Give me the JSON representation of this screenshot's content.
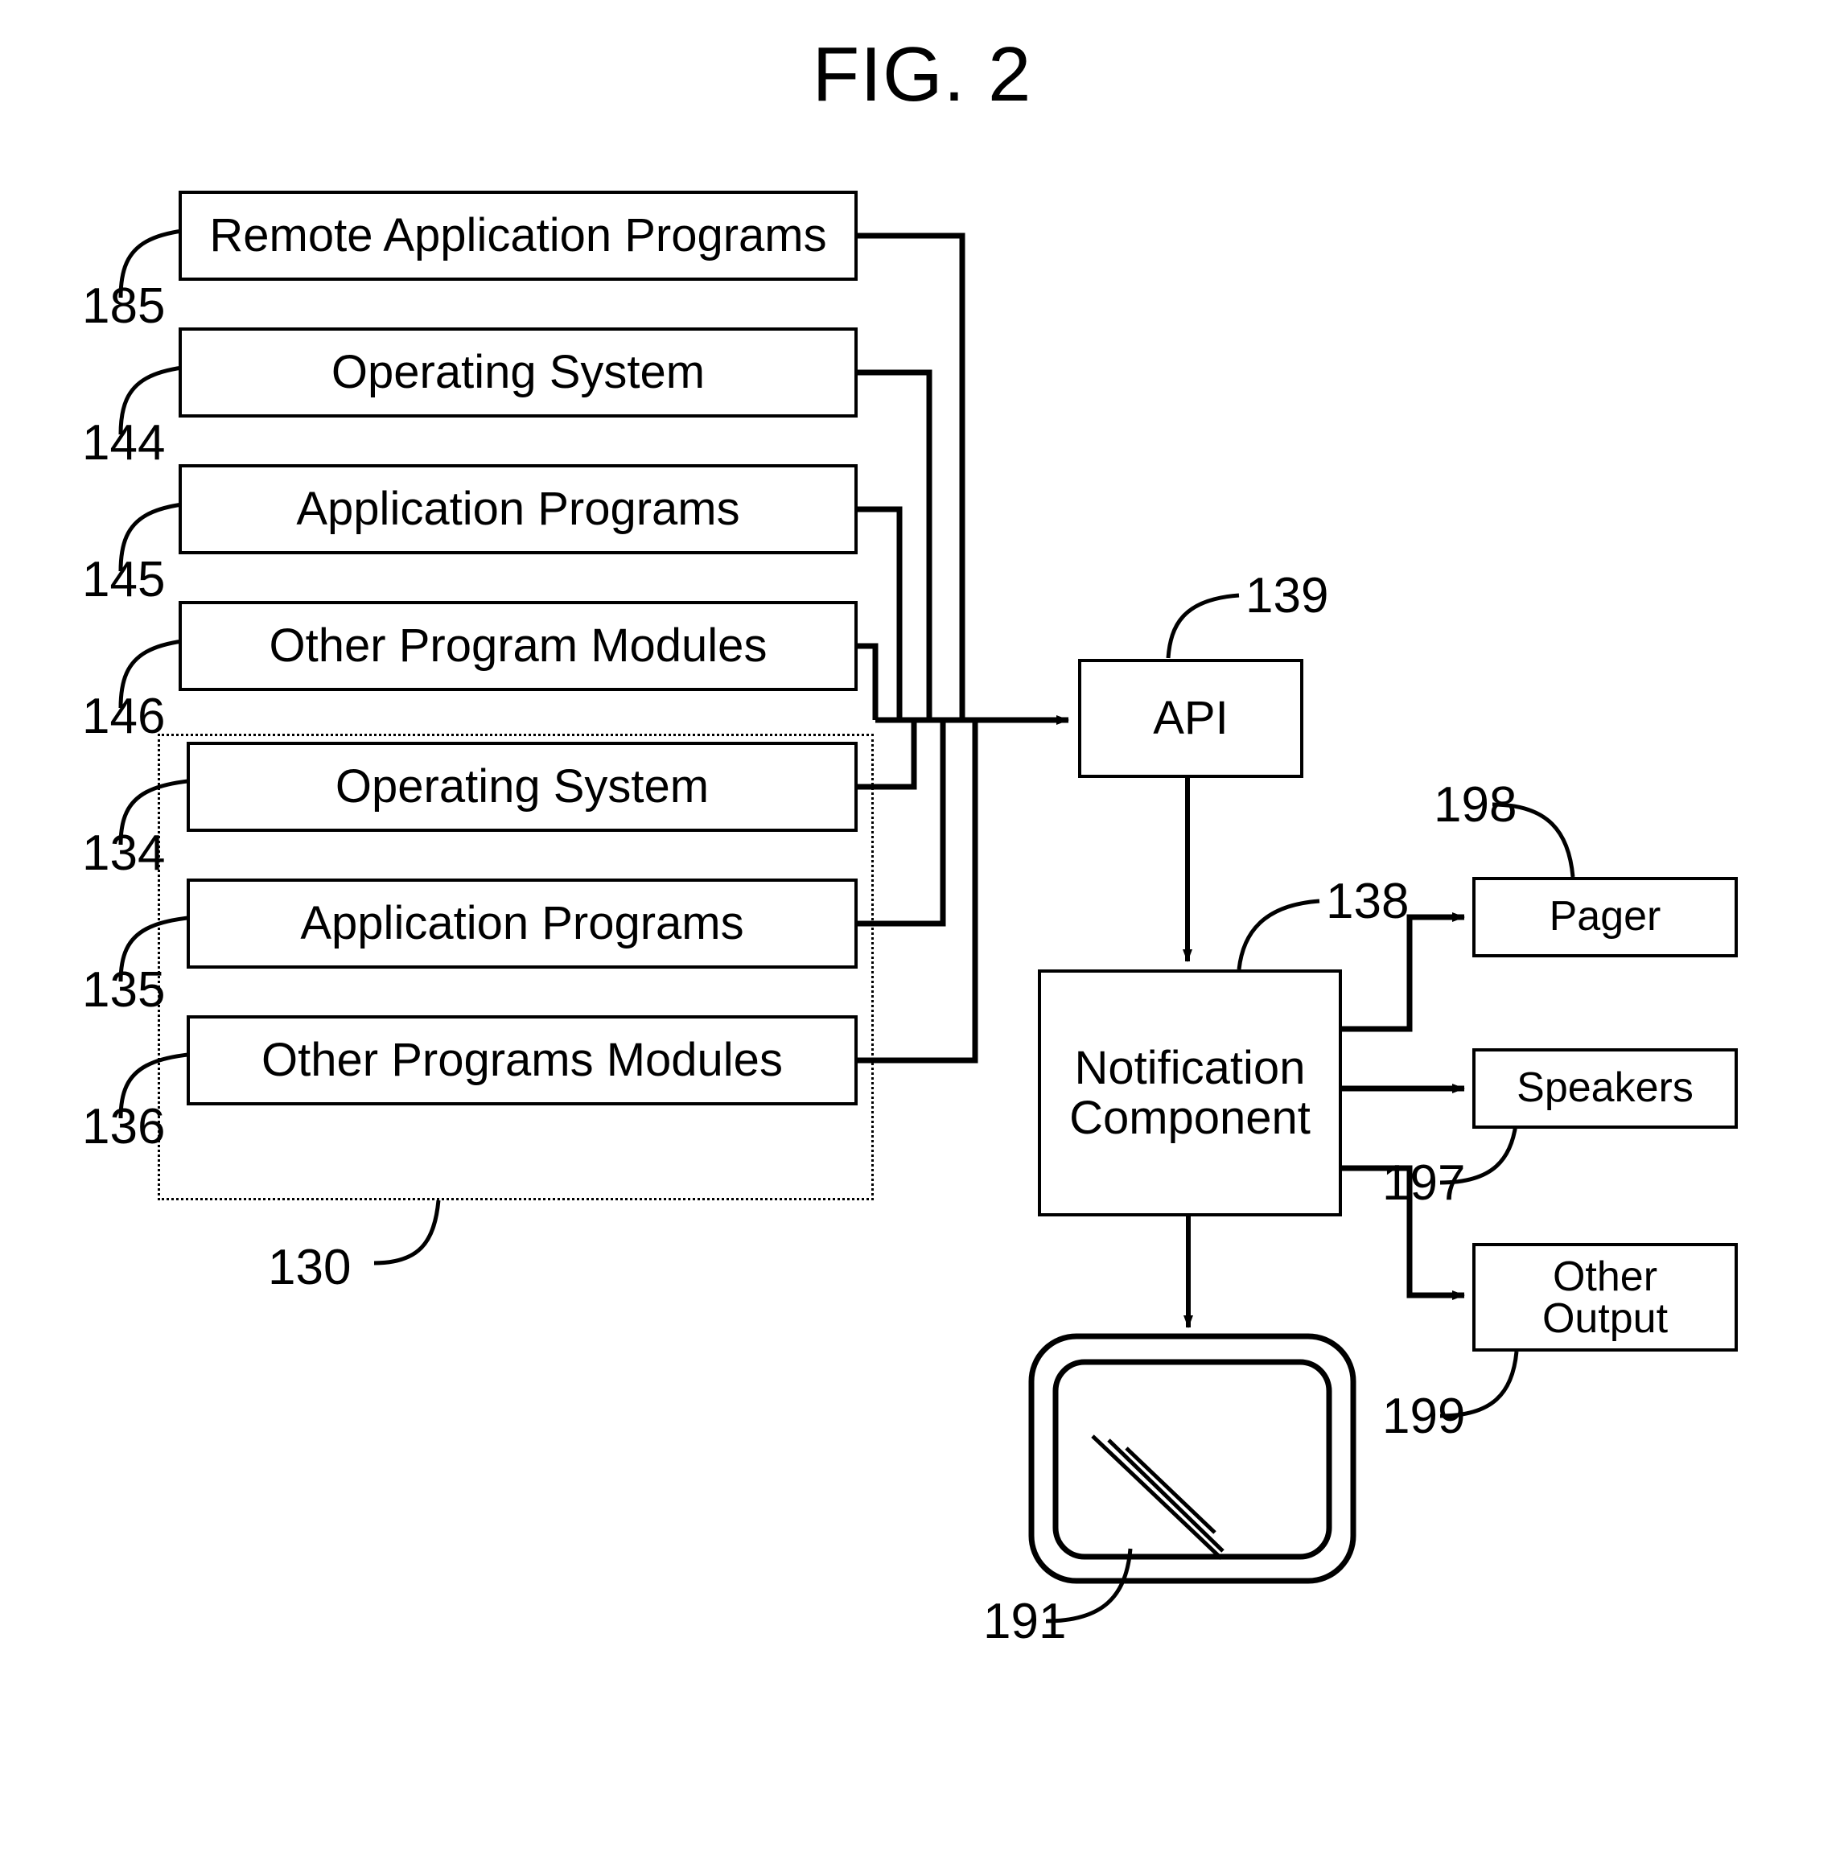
{
  "figure": {
    "title": "FIG. 2",
    "background_color": "#ffffff",
    "line_color": "#000000"
  },
  "nodes": {
    "remote_application_programs": {
      "label": "Remote Application Programs",
      "ref": "185"
    },
    "operating_system_upper": {
      "label": "Operating System",
      "ref": "144"
    },
    "application_programs_upper": {
      "label": "Application Programs",
      "ref": "145"
    },
    "other_program_modules_upper": {
      "label": "Other Program Modules",
      "ref": "146"
    },
    "operating_system_lower": {
      "label": "Operating System",
      "ref": "134"
    },
    "application_programs_lower": {
      "label": "Application Programs",
      "ref": "135"
    },
    "other_programs_modules_lower": {
      "label": "Other Programs Modules",
      "ref": "136"
    },
    "memory_group": {
      "ref": "130"
    },
    "api": {
      "label": "API",
      "ref": "139"
    },
    "notification_component": {
      "label": "Notification\nComponent",
      "label_line1": "Notification",
      "label_line2": "Component",
      "ref": "138"
    },
    "pager": {
      "label": "Pager",
      "ref": "198"
    },
    "speakers": {
      "label": "Speakers",
      "ref": "197"
    },
    "other_output": {
      "label": "Other\nOutput",
      "label_line1": "Other",
      "label_line2": "Output",
      "ref": "199"
    },
    "display_monitor": {
      "label": "",
      "ref": "191"
    }
  },
  "ref_numbers": {
    "n185": "185",
    "n144": "144",
    "n145": "145",
    "n146": "146",
    "n134": "134",
    "n135": "135",
    "n136": "136",
    "n130": "130",
    "n139": "139",
    "n138": "138",
    "n198": "198",
    "n197": "197",
    "n199": "199",
    "n191": "191"
  }
}
